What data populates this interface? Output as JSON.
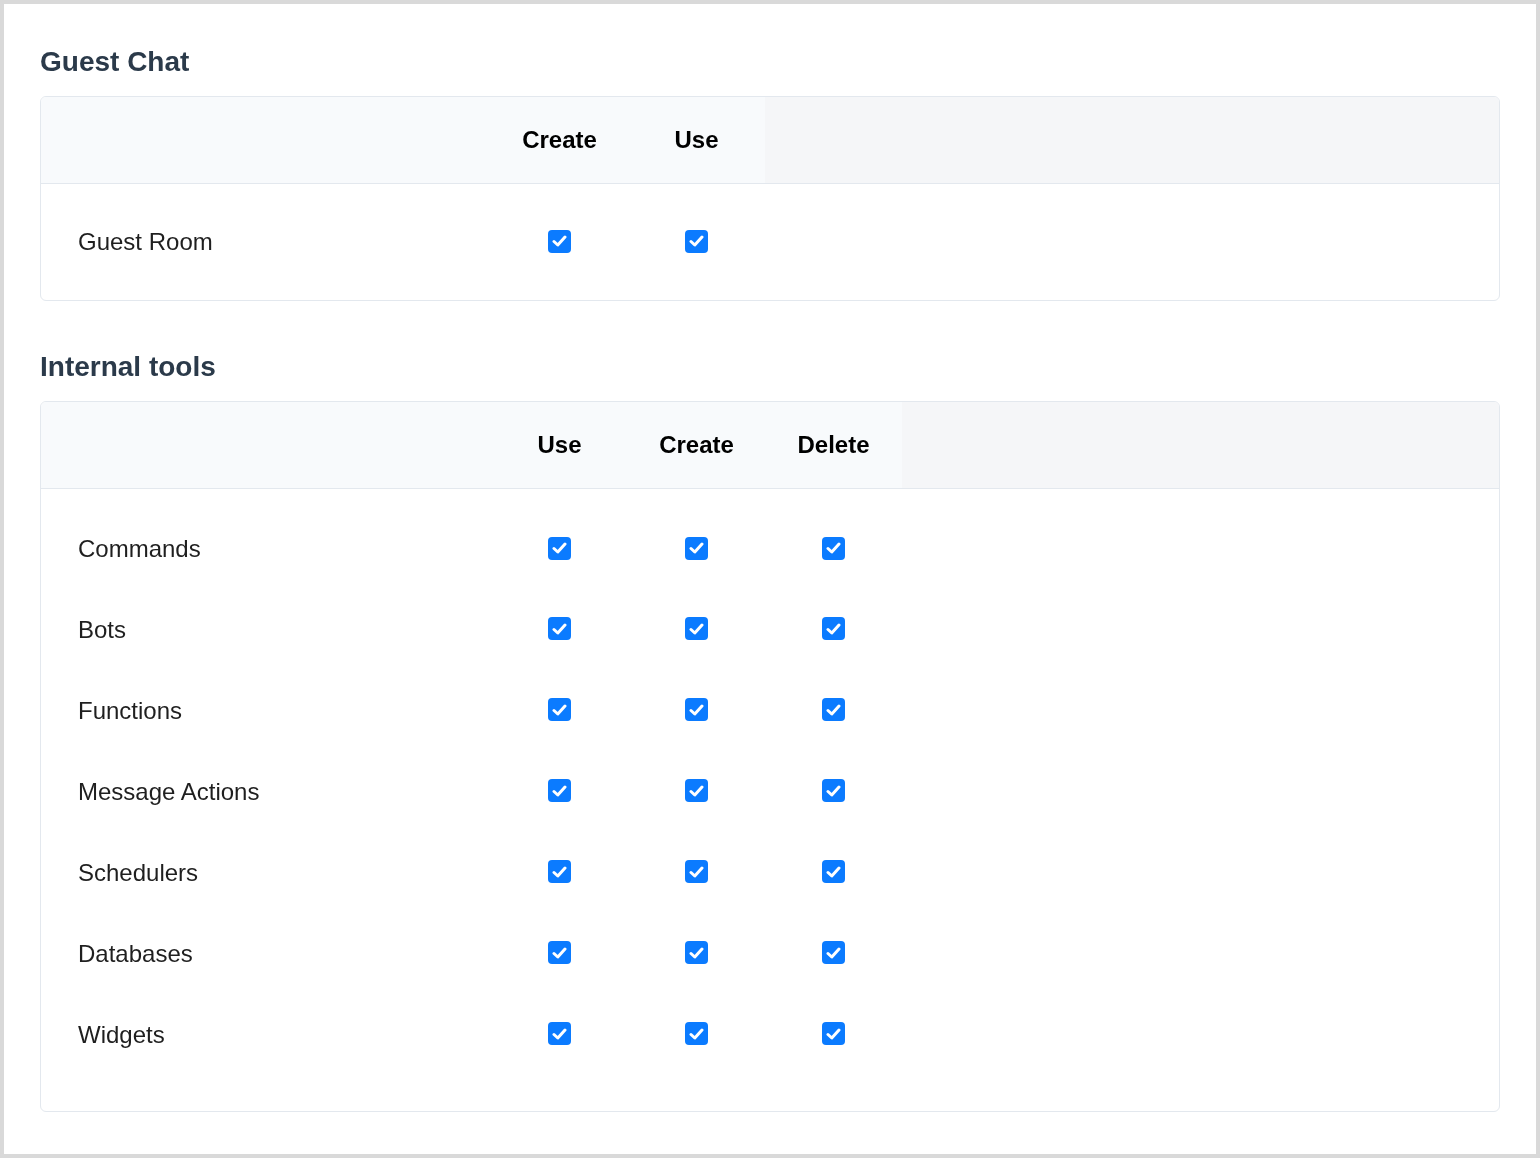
{
  "sections": [
    {
      "title": "Guest Chat",
      "columns": [
        "Create",
        "Use"
      ],
      "rows": [
        {
          "label": "Guest Room",
          "cells": [
            {
              "checked": true
            },
            {
              "checked": true
            }
          ]
        }
      ]
    },
    {
      "title": "Internal tools",
      "columns": [
        "Use",
        "Create",
        "Delete"
      ],
      "rows": [
        {
          "label": "Commands",
          "cells": [
            {
              "checked": true
            },
            {
              "checked": true
            },
            {
              "checked": true
            }
          ]
        },
        {
          "label": "Bots",
          "cells": [
            {
              "checked": true
            },
            {
              "checked": true
            },
            {
              "checked": true
            }
          ]
        },
        {
          "label": "Functions",
          "cells": [
            {
              "checked": true
            },
            {
              "checked": true
            },
            {
              "checked": true
            }
          ]
        },
        {
          "label": "Message Actions",
          "cells": [
            {
              "checked": true
            },
            {
              "checked": true
            },
            {
              "checked": true
            }
          ]
        },
        {
          "label": "Schedulers",
          "cells": [
            {
              "checked": true
            },
            {
              "checked": true
            },
            {
              "checked": true
            }
          ]
        },
        {
          "label": "Databases",
          "cells": [
            {
              "checked": true
            },
            {
              "checked": true
            },
            {
              "checked": true
            }
          ]
        },
        {
          "label": "Widgets",
          "cells": [
            {
              "checked": true
            },
            {
              "checked": true
            },
            {
              "checked": true
            }
          ]
        }
      ]
    }
  ]
}
